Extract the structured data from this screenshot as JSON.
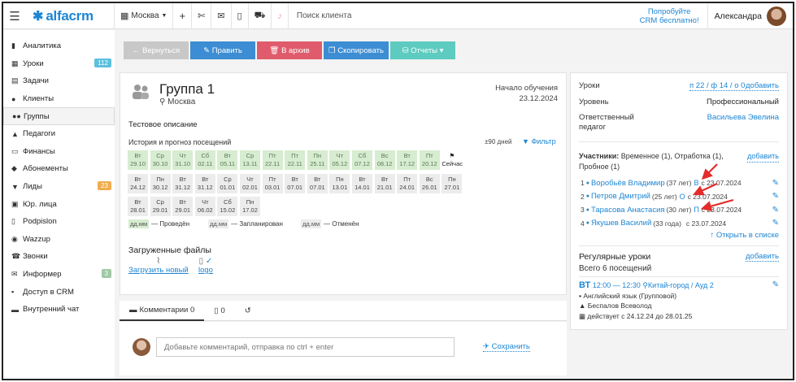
{
  "topbar": {
    "logo_text": "alfacrm",
    "city": "Москва",
    "search_placeholder": "Поиск клиента",
    "promo_line1": "Попробуйте",
    "promo_line2": "CRM бесплатно!",
    "user_name": "Александра"
  },
  "sidebar": {
    "items": [
      {
        "label": "Аналитика",
        "icon": "analytics-icon",
        "glyph": "▮"
      },
      {
        "label": "Уроки",
        "icon": "calendar-icon",
        "glyph": "▦",
        "badge": "112",
        "badge_color": "#5bc0de"
      },
      {
        "label": "Задачи",
        "icon": "tasks-icon",
        "glyph": "▤"
      },
      {
        "label": "Клиенты",
        "icon": "user-icon",
        "glyph": "●"
      },
      {
        "label": "Группы",
        "icon": "users-icon",
        "glyph": "●●"
      },
      {
        "label": "Педагоги",
        "icon": "graduation-cap-icon",
        "glyph": "▲"
      },
      {
        "label": "Финансы",
        "icon": "money-icon",
        "glyph": "▭"
      },
      {
        "label": "Абонементы",
        "icon": "subscriptions-icon",
        "glyph": "◆"
      },
      {
        "label": "Лиды",
        "icon": "funnel-icon",
        "glyph": "▼",
        "badge": "23",
        "badge_color": "#f0ad4e"
      },
      {
        "label": "Юр. лица",
        "icon": "building-icon",
        "glyph": "▣"
      },
      {
        "label": "Podpislon",
        "icon": "document-icon",
        "glyph": "▯"
      },
      {
        "label": "Wazzup",
        "icon": "whatsapp-icon",
        "glyph": "◉"
      },
      {
        "label": "Звонки",
        "icon": "phone-icon",
        "glyph": "☎"
      },
      {
        "label": "Информер",
        "icon": "envelope-icon",
        "glyph": "✉",
        "badge": "3",
        "badge_color": "#9fc9a6"
      },
      {
        "label": "Доступ в CRM",
        "icon": "lock-icon",
        "glyph": "▪"
      },
      {
        "label": "Внутренний чат",
        "icon": "chat-icon",
        "glyph": "▬"
      }
    ]
  },
  "actions": [
    {
      "label": "← Вернуться",
      "color": "#c8c8c8",
      "width": 80
    },
    {
      "label": "✎ Править",
      "color": "#3c8dd3",
      "width": 80
    },
    {
      "label": "🗑 В архив",
      "color": "#e05c6c",
      "width": 80
    },
    {
      "label": "❐ Скопировать",
      "color": "#3c8dd3",
      "width": 80
    },
    {
      "label": "⛁ Отчеты ▾",
      "color": "#5dcbc0",
      "width": 80
    }
  ],
  "group": {
    "title": "Группа 1",
    "city": "Москва",
    "start_label": "Начало обучения",
    "start_date": "23.12.2024",
    "description": "Тестовое описание",
    "history_title": "История и прогноз посещений",
    "days": "±90 дней",
    "filter": "Фильтр"
  },
  "calendar": [
    {
      "d": "Вт",
      "n": "29.10",
      "s": "past"
    },
    {
      "d": "Ср",
      "n": "30.10",
      "s": "past"
    },
    {
      "d": "Чт",
      "n": "31.10",
      "s": "past"
    },
    {
      "d": "Сб",
      "n": "02.11",
      "s": "past"
    },
    {
      "d": "Вт",
      "n": "05.11",
      "s": "past"
    },
    {
      "d": "Ср",
      "n": "13.11",
      "s": "past"
    },
    {
      "d": "Пт",
      "n": "22.11",
      "s": "past"
    },
    {
      "d": "Пт",
      "n": "22.11",
      "s": "past"
    },
    {
      "d": "Пн",
      "n": "25.11",
      "s": "past"
    },
    {
      "d": "Чт",
      "n": "05.12",
      "s": "past"
    },
    {
      "d": "Сб",
      "n": "07.12",
      "s": "past"
    },
    {
      "d": "Вс",
      "n": "08.12",
      "s": "past"
    },
    {
      "d": "Вт",
      "n": "17.12",
      "s": "past"
    },
    {
      "d": "Пт",
      "n": "20.12",
      "s": "past"
    },
    {
      "d": "⚑",
      "n": "Сейчас",
      "s": "now"
    },
    {
      "d": "Вт",
      "n": "24.12",
      "s": "plan"
    },
    {
      "d": "Пн",
      "n": "30.12",
      "s": "plan"
    },
    {
      "d": "Вт",
      "n": "31.12",
      "s": "plan"
    },
    {
      "d": "Вт",
      "n": "31.12",
      "s": "plan"
    },
    {
      "d": "Ср",
      "n": "01.01",
      "s": "plan"
    },
    {
      "d": "Чт",
      "n": "02.01",
      "s": "plan"
    },
    {
      "d": "Пт",
      "n": "03.01",
      "s": "plan"
    },
    {
      "d": "Вт",
      "n": "07.01",
      "s": "plan"
    },
    {
      "d": "Вт",
      "n": "07.01",
      "s": "plan"
    },
    {
      "d": "Пн",
      "n": "13.01",
      "s": "plan"
    },
    {
      "d": "Вт",
      "n": "14.01",
      "s": "plan"
    },
    {
      "d": "Вт",
      "n": "21.01",
      "s": "plan"
    },
    {
      "d": "Пт",
      "n": "24.01",
      "s": "plan"
    },
    {
      "d": "Вс",
      "n": "26.01",
      "s": "plan"
    },
    {
      "d": "Пн",
      "n": "27.01",
      "s": "plan"
    },
    {
      "d": "Вт",
      "n": "28.01",
      "s": "plan"
    },
    {
      "d": "Ср",
      "n": "29.01",
      "s": "plan"
    },
    {
      "d": "Вт",
      "n": "29.01",
      "s": "plan"
    },
    {
      "d": "Чт",
      "n": "06.02",
      "s": "plan"
    },
    {
      "d": "Сб",
      "n": "15.02",
      "s": "plan"
    },
    {
      "d": "Пн",
      "n": "17.02",
      "s": "plan"
    }
  ],
  "legend": {
    "box": "дд.мм",
    "done": "— Проведён",
    "planned": "— Запланирован",
    "cancelled": "— Отменён"
  },
  "files": {
    "title": "Загруженные файлы",
    "upload": "Загрузить новый",
    "logo": "logo"
  },
  "comments": {
    "tab_comments": "Комментарии 0",
    "tab_files": "0",
    "placeholder": "Добавьте комментарий, отправка по ctrl + enter",
    "save": "Сохранить"
  },
  "right": {
    "lessons_label": "Уроки",
    "lessons_value": "п 22 / ф 14 / о 0",
    "add": "добавить",
    "level_label": "Уровень",
    "level_value": "Профессиональный",
    "resp_label1": "Ответственный",
    "resp_label2": "педагог",
    "resp_value": "Васильева Эвелина",
    "participants_head": "Участники:",
    "participants_desc": "Временное (1), Отработка (1),",
    "participants_desc2": "Пробное (1)",
    "students": [
      {
        "num": "1",
        "name": "Воробьёв Владимир",
        "age": "(37 лет)",
        "tag": "В",
        "since": "с 23.07.2024"
      },
      {
        "num": "2",
        "name": "Петров Дмитрий",
        "age": "(25 лет)",
        "tag": "О",
        "since": "с 23.07.2024"
      },
      {
        "num": "3",
        "name": "Тарасова Анастасия",
        "age": "(30 лет)",
        "tag": "П",
        "since": "с 23.07.2024"
      },
      {
        "num": "4",
        "name": "Якушев Василий",
        "age": "(33 года)",
        "tag": "",
        "since": "с 23.07.2024"
      }
    ],
    "open_list": "↑ Открыть в списке",
    "regular_title": "Регулярные уроки",
    "regular_total": "Всего 6 посещений",
    "lesson_day": "ВТ",
    "lesson_time": "12:00 — 12:30",
    "lesson_place": "Китай-город / Ауд 2",
    "lesson_subject": "Английский язык (Групповой)",
    "lesson_teacher": "Беспалов Всеволод",
    "lesson_period": "действует с 24.12.24 до 28.01.25"
  },
  "colors": {
    "accent": "#1d86d4",
    "arrow": "#e52b2b"
  }
}
